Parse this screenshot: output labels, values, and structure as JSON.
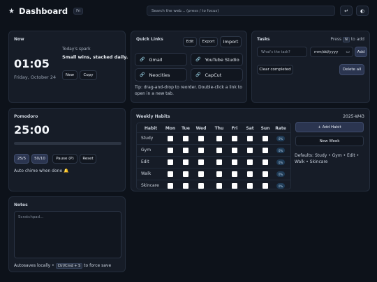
{
  "header": {
    "title": "Dashboard",
    "badge": "Fri",
    "search_placeholder": "Search the web… (press / to focus)",
    "enter_icon": "↵",
    "theme_icon": "◐"
  },
  "now": {
    "title": "Now",
    "time": "01:05",
    "date": "Friday, October 24",
    "spark_label": "Today's spark",
    "spark_text": "Small wins, stacked daily.",
    "new_label": "New",
    "copy_label": "Copy"
  },
  "quick_links": {
    "title": "Quick Links",
    "edit_label": "Edit",
    "export_label": "Export",
    "import_label": "Import",
    "links": [
      {
        "label": "Gmail"
      },
      {
        "label": "YouTube Studio"
      },
      {
        "label": "Neocities"
      },
      {
        "label": "CapCut"
      }
    ],
    "tip": "Tip: drag-and-drop to reorder. Double-click a link to open in a new tab."
  },
  "tasks": {
    "title": "Tasks",
    "press_prefix": "Press",
    "press_key": "N",
    "press_suffix": "to add",
    "input_placeholder": "What's the task?",
    "date_placeholder": "mm/dd/yyyy",
    "add_label": "Add",
    "clear_label": "Clear completed",
    "delete_label": "Delete all"
  },
  "pomodoro": {
    "title": "Pomodoro",
    "time": "25:00",
    "progress": 0,
    "presets": [
      "25/5",
      "50/10"
    ],
    "pause_label": "Pause (P)",
    "reset_label": "Reset",
    "chime_text": "Auto chime when done 🔔"
  },
  "habits": {
    "title": "Weekly Habits",
    "week": "2025-W43",
    "columns": [
      "Habit",
      "Mon",
      "Tue",
      "Wed",
      "Thu",
      "Fri",
      "Sat",
      "Sun",
      "Rate"
    ],
    "rows": [
      {
        "name": "Study",
        "rate": "0%"
      },
      {
        "name": "Gym",
        "rate": "0%"
      },
      {
        "name": "Edit",
        "rate": "0%"
      },
      {
        "name": "Walk",
        "rate": "0%"
      },
      {
        "name": "Skincare",
        "rate": "0%"
      }
    ],
    "add_label": "+ Add Habit",
    "new_week_label": "New Week",
    "defaults_text": "Defaults: Study • Gym • Edit • Walk • Skincare"
  },
  "notes": {
    "title": "Notes",
    "placeholder": "Scratchpad…",
    "autosave_prefix": "Autosaves locally •",
    "autosave_key": "Ctrl/Cmd + S",
    "autosave_suffix": "to force save"
  }
}
